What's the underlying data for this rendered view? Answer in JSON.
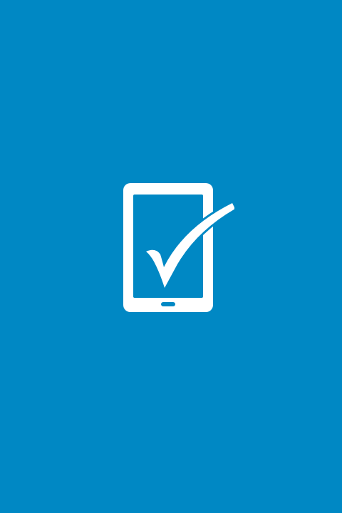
{
  "splash": {
    "background_color": "#0088c4",
    "logo": {
      "icon": "tablet-checkmark-icon",
      "color": "#ffffff"
    }
  }
}
